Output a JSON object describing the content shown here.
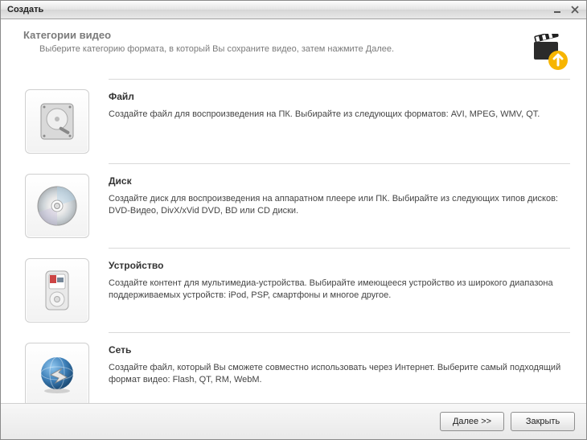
{
  "window": {
    "title": "Создать"
  },
  "header": {
    "title": "Категории видео",
    "subtitle": "Выберите категорию формата, в который Вы сохраните видео, затем нажмите Далее."
  },
  "categories": [
    {
      "icon": "hdd-icon",
      "title": "Файл",
      "desc": "Создайте файл для воспроизведения на ПК. Выбирайте из следующих форматов: AVI, MPEG, WMV, QT."
    },
    {
      "icon": "disc-icon",
      "title": "Диск",
      "desc": "Создайте диск для воспроизведения на аппаратном плеере или ПК. Выбирайте из следующих типов дисков: DVD-Видео, DivX/xVid DVD, BD или CD диски."
    },
    {
      "icon": "device-icon",
      "title": "Устройство",
      "desc": "Создайте контент для мультимедиа-устройства. Выбирайте имеющееся устройство из широкого диапазона поддерживаемых устройств: iPod, PSP, смартфоны и многое другое."
    },
    {
      "icon": "globe-icon",
      "title": "Сеть",
      "desc": "Создайте файл, который Вы сможете совместно использовать через Интернет. Выберите самый подходящий формат видео: Flash, QT, RM, WebM."
    }
  ],
  "footer": {
    "next": "Далее >>",
    "close": "Закрыть"
  }
}
